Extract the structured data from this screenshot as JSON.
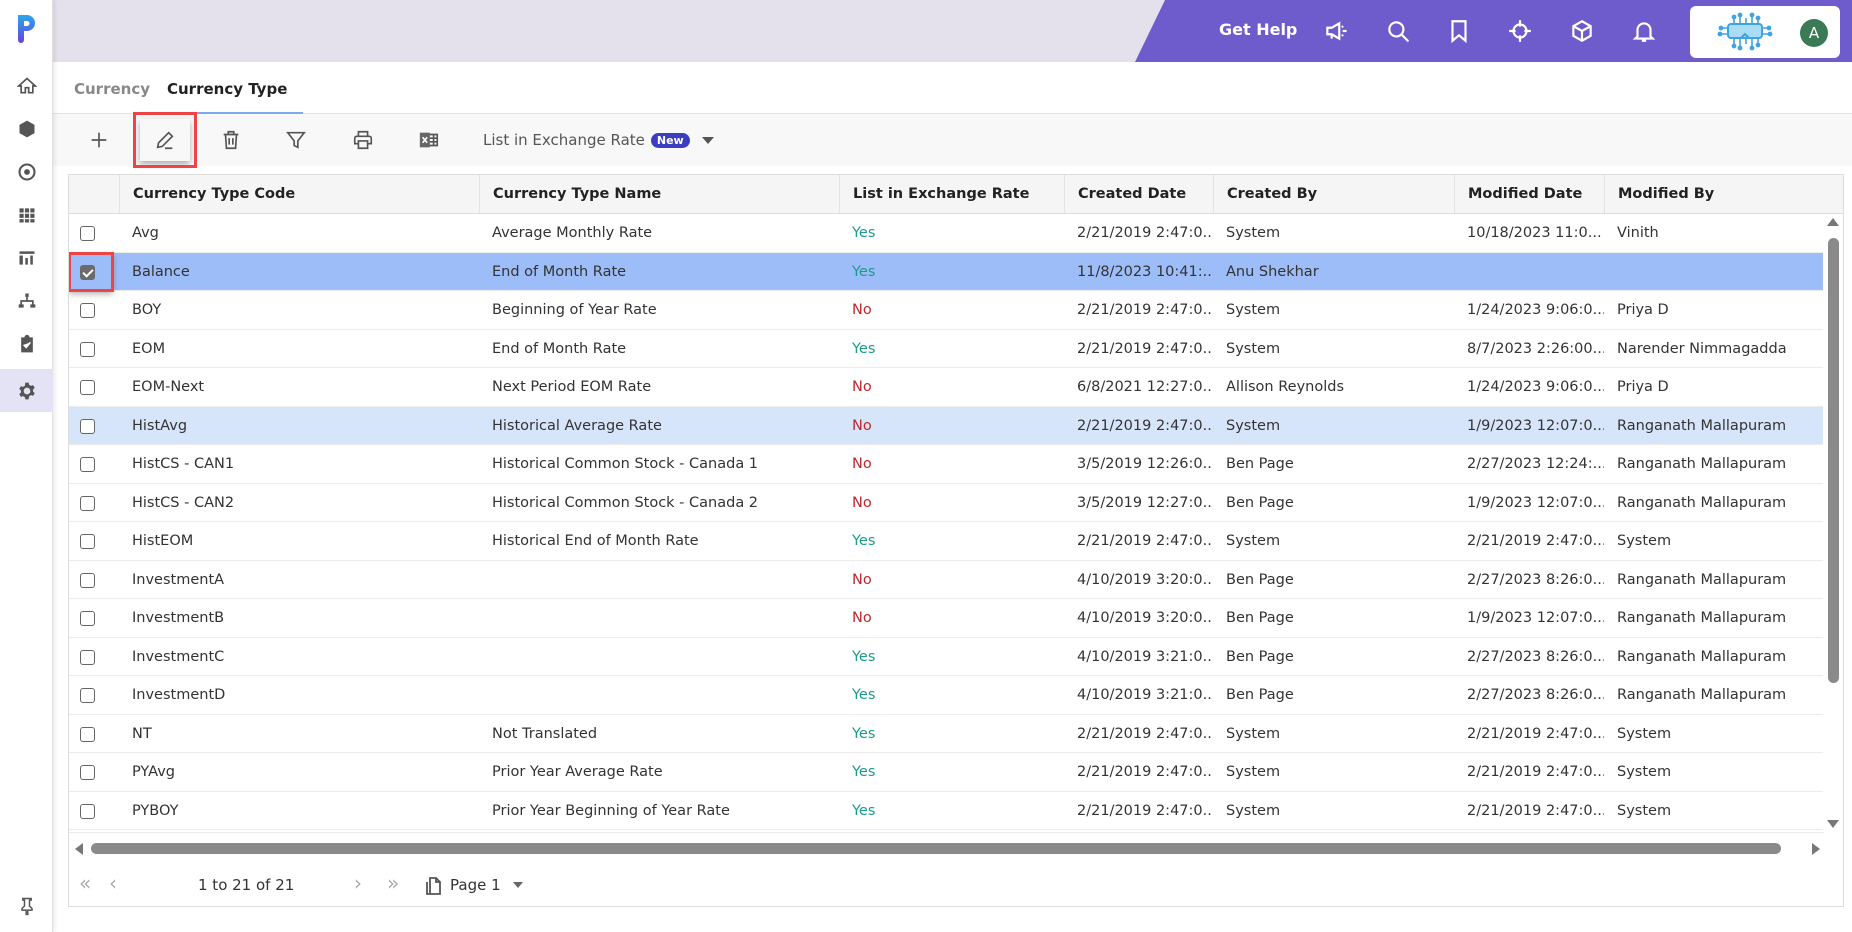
{
  "sidebar": {
    "logo": "P",
    "items": [
      {
        "icon": "home-icon"
      },
      {
        "icon": "cube-icon"
      },
      {
        "icon": "target-icon"
      },
      {
        "icon": "grid-icon"
      },
      {
        "icon": "chart-icon"
      },
      {
        "icon": "hierarchy-icon"
      },
      {
        "icon": "clipboard-check-icon"
      },
      {
        "icon": "gear-icon",
        "active": true
      }
    ],
    "pin_icon": "pin-icon"
  },
  "header": {
    "get_help": "Get Help",
    "icons": [
      "megaphone-icon",
      "search-icon",
      "bookmark-icon",
      "crosshair-icon",
      "box-icon",
      "bell-icon"
    ],
    "avatar_initial": "A",
    "brand_color": "#6f5ccc"
  },
  "tabs": [
    {
      "label": "Currency",
      "active": false
    },
    {
      "label": "Currency Type",
      "active": true
    }
  ],
  "toolbar": {
    "buttons": [
      "add",
      "edit",
      "delete",
      "filter",
      "print",
      "export-excel"
    ],
    "list_in_exchange_rate": "List in Exchange Rate",
    "new_badge": "New"
  },
  "grid": {
    "columns": [
      "Currency Type Code",
      "Currency Type Name",
      "List in Exchange Rate",
      "Created Date",
      "Created By",
      "Modified Date",
      "Modified By"
    ],
    "rows": [
      {
        "code": "Avg",
        "name": "Average Monthly Rate",
        "list": "Yes",
        "created": "2/21/2019 2:47:0...",
        "created_by": "System",
        "modified": "10/18/2023 11:0...",
        "modified_by": "Vinith",
        "checked": false
      },
      {
        "code": "Balance",
        "name": "End of Month Rate",
        "list": "Yes",
        "created": "11/8/2023 10:41:...",
        "created_by": "Anu Shekhar",
        "modified": "",
        "modified_by": "",
        "checked": true,
        "state": "selected"
      },
      {
        "code": "BOY",
        "name": "Beginning of Year Rate",
        "list": "No",
        "created": "2/21/2019 2:47:0...",
        "created_by": "System",
        "modified": "1/24/2023 9:06:0...",
        "modified_by": "Priya D",
        "checked": false
      },
      {
        "code": "EOM",
        "name": "End of Month Rate",
        "list": "Yes",
        "created": "2/21/2019 2:47:0...",
        "created_by": "System",
        "modified": "8/7/2023 2:26:00...",
        "modified_by": "Narender Nimmagadda",
        "checked": false
      },
      {
        "code": "EOM-Next",
        "name": "Next Period EOM Rate",
        "list": "No",
        "created": "6/8/2021 12:27:0...",
        "created_by": "Allison Reynolds",
        "modified": "1/24/2023 9:06:0...",
        "modified_by": "Priya D",
        "checked": false
      },
      {
        "code": "HistAvg",
        "name": "Historical Average Rate",
        "list": "No",
        "created": "2/21/2019 2:47:0...",
        "created_by": "System",
        "modified": "1/9/2023 12:07:0...",
        "modified_by": "Ranganath Mallapuram",
        "checked": false,
        "state": "hover"
      },
      {
        "code": "HistCS - CAN1",
        "name": "Historical Common Stock - Canada 1",
        "list": "No",
        "created": "3/5/2019 12:26:0...",
        "created_by": "Ben Page",
        "modified": "2/27/2023 12:24:...",
        "modified_by": "Ranganath Mallapuram",
        "checked": false
      },
      {
        "code": "HistCS - CAN2",
        "name": "Historical Common Stock - Canada 2",
        "list": "No",
        "created": "3/5/2019 12:27:0...",
        "created_by": "Ben Page",
        "modified": "1/9/2023 12:07:0...",
        "modified_by": "Ranganath Mallapuram",
        "checked": false
      },
      {
        "code": "HistEOM",
        "name": "Historical End of Month Rate",
        "list": "Yes",
        "created": "2/21/2019 2:47:0...",
        "created_by": "System",
        "modified": "2/21/2019 2:47:0...",
        "modified_by": "System",
        "checked": false
      },
      {
        "code": "InvestmentA",
        "name": "",
        "list": "No",
        "created": "4/10/2019 3:20:0...",
        "created_by": "Ben Page",
        "modified": "2/27/2023 8:26:0...",
        "modified_by": "Ranganath Mallapuram",
        "checked": false
      },
      {
        "code": "InvestmentB",
        "name": "",
        "list": "No",
        "created": "4/10/2019 3:20:0...",
        "created_by": "Ben Page",
        "modified": "1/9/2023 12:07:0...",
        "modified_by": "Ranganath Mallapuram",
        "checked": false
      },
      {
        "code": "InvestmentC",
        "name": "",
        "list": "Yes",
        "created": "4/10/2019 3:21:0...",
        "created_by": "Ben Page",
        "modified": "2/27/2023 8:26:0...",
        "modified_by": "Ranganath Mallapuram",
        "checked": false
      },
      {
        "code": "InvestmentD",
        "name": "",
        "list": "Yes",
        "created": "4/10/2019 3:21:0...",
        "created_by": "Ben Page",
        "modified": "2/27/2023 8:26:0...",
        "modified_by": "Ranganath Mallapuram",
        "checked": false
      },
      {
        "code": "NT",
        "name": "Not Translated",
        "list": "Yes",
        "created": "2/21/2019 2:47:0...",
        "created_by": "System",
        "modified": "2/21/2019 2:47:0...",
        "modified_by": "System",
        "checked": false
      },
      {
        "code": "PYAvg",
        "name": "Prior Year Average Rate",
        "list": "Yes",
        "created": "2/21/2019 2:47:0...",
        "created_by": "System",
        "modified": "2/21/2019 2:47:0...",
        "modified_by": "System",
        "checked": false
      },
      {
        "code": "PYBOY",
        "name": "Prior Year Beginning of Year Rate",
        "list": "Yes",
        "created": "2/21/2019 2:47:0...",
        "created_by": "System",
        "modified": "2/21/2019 2:47:0...",
        "modified_by": "System",
        "checked": false
      }
    ],
    "colors": {
      "yes": "#1a9b8c",
      "no": "#c0262d",
      "selected_row": "#9cbdf8",
      "hover_row": "#d7e5fb"
    }
  },
  "pager": {
    "count_text": "1 to 21 of 21",
    "page_label": "Page 1"
  }
}
